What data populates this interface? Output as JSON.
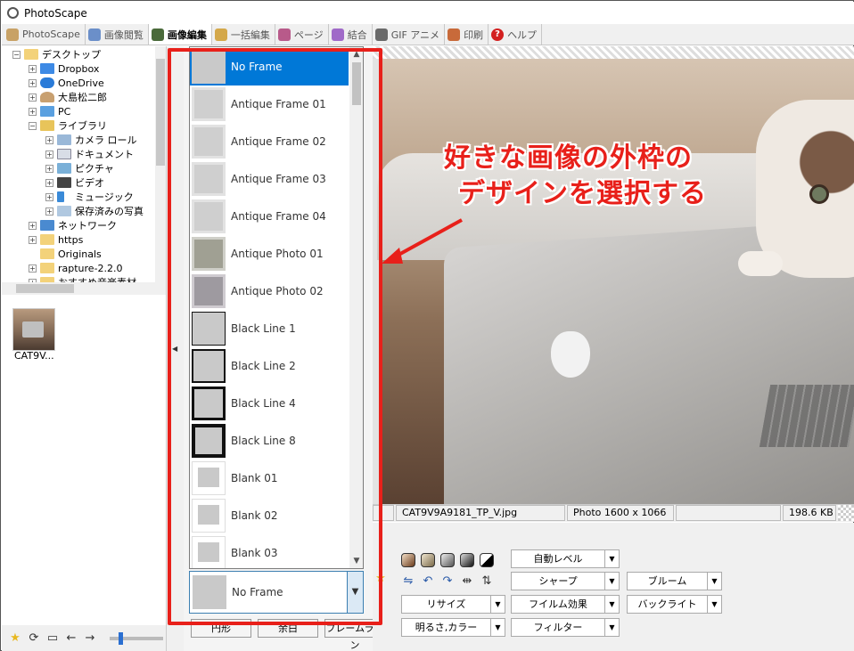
{
  "window": {
    "title": "PhotoScape"
  },
  "tabs": [
    {
      "label": "PhotoScape",
      "active": false,
      "icon": "photoscape-icon"
    },
    {
      "label": "画像閲覧",
      "active": false,
      "icon": "viewer-icon"
    },
    {
      "label": "画像編集",
      "active": true,
      "icon": "editor-icon"
    },
    {
      "label": "一括編集",
      "active": false,
      "icon": "batch-icon"
    },
    {
      "label": "ページ",
      "active": false,
      "icon": "page-icon"
    },
    {
      "label": "結合",
      "active": false,
      "icon": "combine-icon"
    },
    {
      "label": "GIF アニメ",
      "active": false,
      "icon": "gif-icon"
    },
    {
      "label": "印刷",
      "active": false,
      "icon": "print-icon"
    },
    {
      "label": "ヘルプ",
      "active": false,
      "icon": "help-icon"
    }
  ],
  "tree": [
    {
      "label": "デスクトップ",
      "expander": "−",
      "icon": "folder-icon"
    },
    {
      "label": "Dropbox",
      "expander": "+",
      "icon": "dropbox-icon"
    },
    {
      "label": "OneDrive",
      "expander": "+",
      "icon": "onedrive-icon"
    },
    {
      "label": "大島松二郎",
      "expander": "+",
      "icon": "user-icon"
    },
    {
      "label": "PC",
      "expander": "+",
      "icon": "pc-icon"
    },
    {
      "label": "ライブラリ",
      "expander": "−",
      "icon": "library-icon"
    },
    {
      "label": "カメラ ロール",
      "expander": "+",
      "icon": "camera-roll-icon"
    },
    {
      "label": "ドキュメント",
      "expander": "+",
      "icon": "documents-icon"
    },
    {
      "label": "ピクチャ",
      "expander": "+",
      "icon": "pictures-icon"
    },
    {
      "label": "ビデオ",
      "expander": "+",
      "icon": "video-icon"
    },
    {
      "label": "ミュージック",
      "expander": "+",
      "icon": "music-icon"
    },
    {
      "label": "保存済みの写真",
      "expander": "+",
      "icon": "saved-photos-icon"
    },
    {
      "label": "ネットワーク",
      "expander": "+",
      "icon": "network-icon"
    },
    {
      "label": "https",
      "expander": "+",
      "icon": "folder-icon"
    },
    {
      "label": "Originals",
      "expander": "",
      "icon": "folder-icon"
    },
    {
      "label": "rapture-2.2.0",
      "expander": "+",
      "icon": "folder-icon"
    },
    {
      "label": "おすすめ音楽素材",
      "expander": "+",
      "icon": "folder-icon"
    }
  ],
  "thumbnail": {
    "label": "CAT9V..."
  },
  "frames": {
    "options": [
      {
        "label": "No Frame",
        "selected": true
      },
      {
        "label": "Antique Frame 01"
      },
      {
        "label": "Antique Frame 02"
      },
      {
        "label": "Antique Frame 03"
      },
      {
        "label": "Antique Frame 04"
      },
      {
        "label": "Antique Photo 01"
      },
      {
        "label": "Antique Photo 02"
      },
      {
        "label": "Black Line 1"
      },
      {
        "label": "Black Line 2"
      },
      {
        "label": "Black Line 4"
      },
      {
        "label": "Black Line 8"
      },
      {
        "label": "Blank 01"
      },
      {
        "label": "Blank 02"
      },
      {
        "label": "Blank 03"
      }
    ],
    "current": "No Frame"
  },
  "under_buttons": [
    "円形",
    "余白",
    "フレームライン"
  ],
  "annotation": {
    "line1": "好きな画像の外枠の",
    "line2": "デザインを選択する",
    "color": "#e8201a"
  },
  "status": {
    "filename": "CAT9V9A9181_TP_V.jpg",
    "dimensions": "Photo 1600 x 1066",
    "filesize": "198.6 KB"
  },
  "tool_buttons": {
    "auto_level": "自動レベル",
    "sharpen": "シャープ",
    "bloom": "ブルーム",
    "resize": "リサイズ",
    "film": "フイルム効果",
    "backlight": "バックライト",
    "brightness": "明るさ,カラー",
    "filter": "フィルター"
  },
  "colors": {
    "accent": "#0078d7",
    "highlight": "#e8201a"
  }
}
